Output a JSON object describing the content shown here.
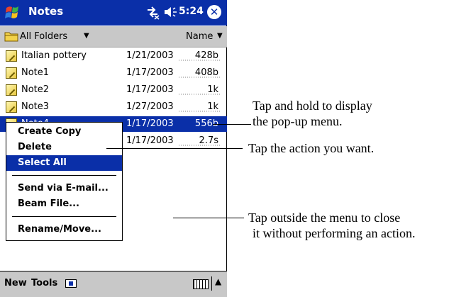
{
  "titlebar": {
    "app_title": "Notes",
    "time": "5:24",
    "close_glyph": "✕"
  },
  "folderbar": {
    "folder_label": "All Folders",
    "sort_label": "Name"
  },
  "notes": [
    {
      "name": "Italian pottery",
      "date": "1/21/2003",
      "size": "428b"
    },
    {
      "name": "Note1",
      "date": "1/17/2003",
      "size": "408b"
    },
    {
      "name": "Note2",
      "date": "1/17/2003",
      "size": "1k"
    },
    {
      "name": "Note3",
      "date": "1/27/2003",
      "size": "1k"
    },
    {
      "name": "Note4",
      "date": "1/17/2003",
      "size": "556b"
    },
    {
      "name": "",
      "date": "1/17/2003",
      "size": "2.7s"
    }
  ],
  "context_menu": {
    "items": [
      "Create Copy",
      "Delete",
      "Select All",
      "Send via E-mail...",
      "Beam File...",
      "Rename/Move..."
    ],
    "highlighted": "Select All"
  },
  "bottombar": {
    "new_label": "New",
    "tools_label": "Tools"
  },
  "callouts": {
    "hold_line1": "Tap and hold to display",
    "hold_line2": "the pop-up menu.",
    "action": "Tap the action you want.",
    "outside_line1": "Tap outside the menu to close",
    "outside_line2": "it without performing an action."
  },
  "colors": {
    "accent": "#0a2fa8",
    "bar_gray": "#c8c8c8"
  },
  "icons": [
    "start-flag-icon",
    "connectivity-icon",
    "speaker-icon",
    "close-icon",
    "folder-icon",
    "note-icon",
    "record-icon",
    "keyboard-icon",
    "sip-arrow-icon"
  ]
}
